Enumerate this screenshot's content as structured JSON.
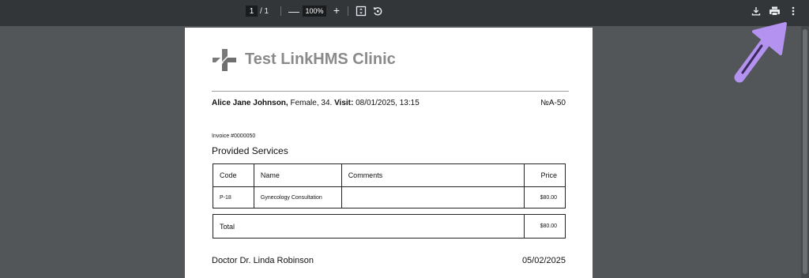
{
  "toolbar": {
    "page_current": "1",
    "page_total": "/ 1",
    "zoom_minus": "—",
    "zoom_value": "100%",
    "zoom_plus": "+"
  },
  "icons": {
    "fit": "fit-page-icon",
    "rotate": "rotate-icon",
    "download": "download-icon",
    "print": "print-icon",
    "more": "more-vert-icon"
  },
  "document": {
    "clinic_name": "Test LinkHMS Clinic",
    "patient_name": "Alice Jane Johnson,",
    "patient_details": " Female, 34. ",
    "visit_label": "Visit:",
    "visit_datetime": " 08/01/2025, 13:15",
    "visit_number": "№A-50",
    "invoice_number": "Invoice #0000050",
    "section_title": "Provided Services",
    "table_headers": {
      "code": "Code",
      "name": "Name",
      "comments": "Comments",
      "price": "Price"
    },
    "rows": [
      {
        "code": "P-18",
        "name": "Gynecology Consultation",
        "comments": "",
        "price": "$80.00"
      }
    ],
    "total_label": "Total",
    "total_price": "$80.00",
    "doctor": "Doctor Dr. Linda Robinson",
    "date": "05/02/2025"
  },
  "colors": {
    "toolbar_bg": "#323639",
    "viewer_bg": "#525659",
    "arrow": "#b392f0"
  }
}
